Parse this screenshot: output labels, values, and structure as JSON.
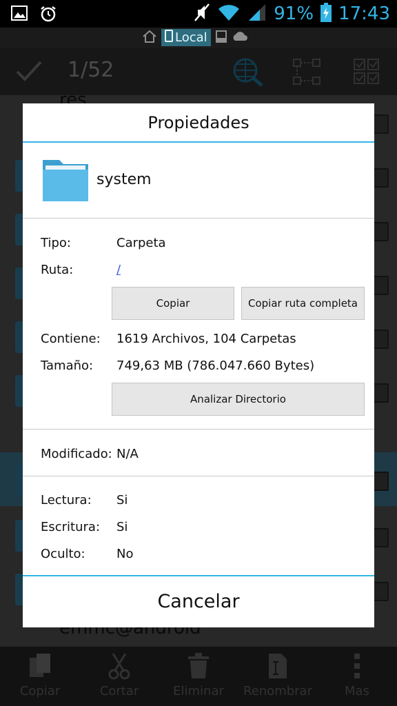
{
  "status_bar": {
    "battery_percent": "91%",
    "time": "17:43",
    "icons": [
      "image-icon",
      "alarm-icon",
      "mute-icon",
      "wifi-icon",
      "signal-icon",
      "battery-icon"
    ]
  },
  "path_bar": {
    "location": "Local",
    "icons": [
      "home-icon",
      "phone-icon",
      "sd-icon",
      "cloud-icon"
    ]
  },
  "action_bar": {
    "counter": "1/52",
    "icons": [
      "check-icon",
      "globe-search-icon",
      "select-tree-icon",
      "select-all-icon"
    ]
  },
  "background_list": {
    "top_item_partial": "res",
    "bottom_item_partial": "emmc@android"
  },
  "bottom_bar": {
    "items": [
      {
        "label": "Copiar",
        "icon": "copy-icon"
      },
      {
        "label": "Cortar",
        "icon": "scissors-icon"
      },
      {
        "label": "Eliminar",
        "icon": "trash-icon"
      },
      {
        "label": "Renombrar",
        "icon": "rename-icon"
      },
      {
        "label": "Mas",
        "icon": "more-icon"
      }
    ]
  },
  "dialog": {
    "title": "Propiedades",
    "folder_name": "system",
    "tipo_label": "Tipo:",
    "tipo_value": "Carpeta",
    "ruta_label": "Ruta:",
    "ruta_value": "/",
    "copy_button": "Copiar",
    "copy_path_button": "Copiar ruta completa",
    "contiene_label": "Contiene:",
    "contiene_value": "1619 Archivos, 104 Carpetas",
    "tamano_label": "Tamaño:",
    "tamano_value": "749,63 MB (786.047.660 Bytes)",
    "analyze_button": "Analizar Directorio",
    "modificado_label": "Modificado:",
    "modificado_value": "N/A",
    "lectura_label": "Lectura:",
    "lectura_value": "Si",
    "escritura_label": "Escritura:",
    "escritura_value": "Si",
    "oculto_label": "Oculto:",
    "oculto_value": "No",
    "cancel_button": "Cancelar"
  },
  "colors": {
    "accent": "#33b5e5",
    "folder": "#5bbbe8",
    "link": "#3b5bdb"
  }
}
